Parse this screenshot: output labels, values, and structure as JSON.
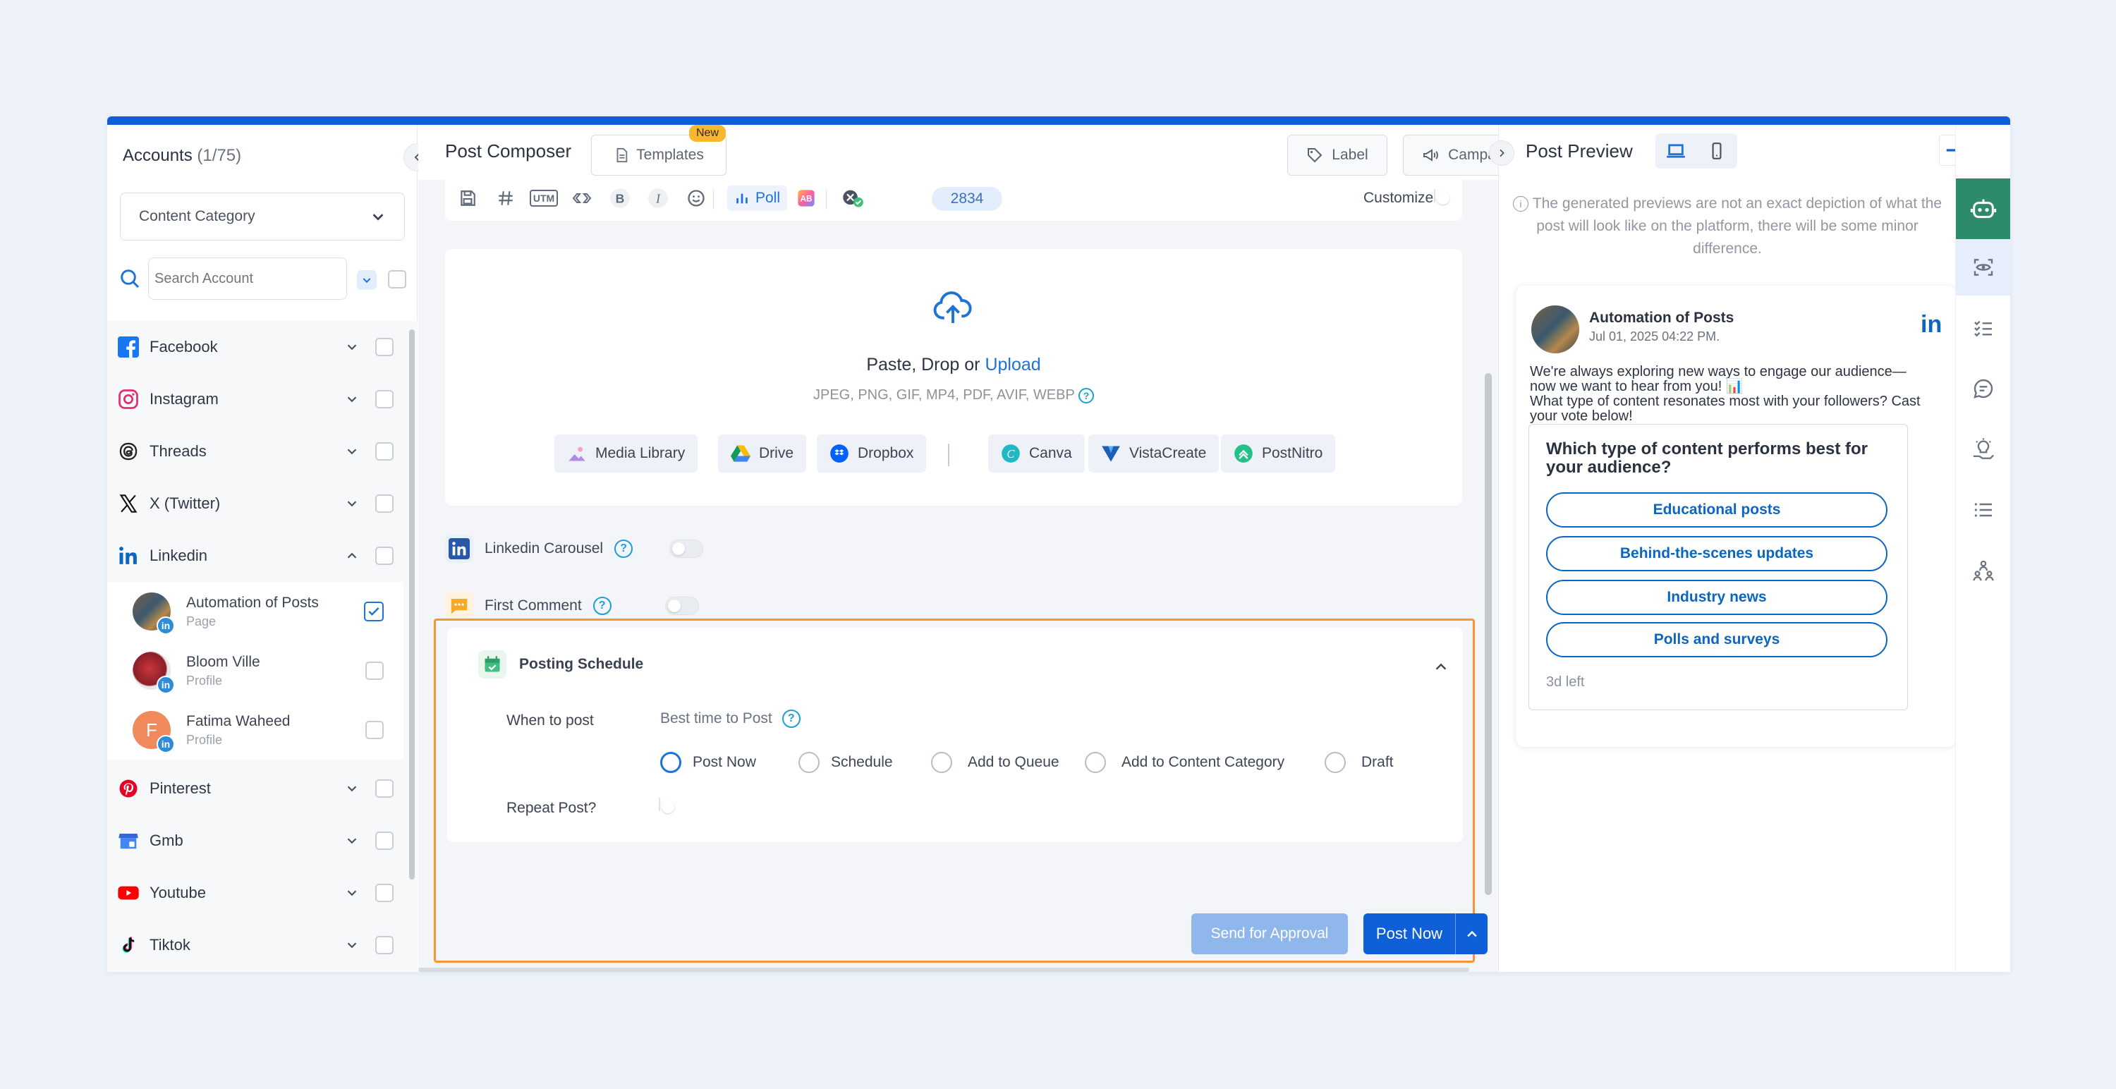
{
  "accounts": {
    "title": "Accounts",
    "count": "(1/75)",
    "category_select": "Content Category",
    "search_placeholder": "Search Account",
    "platforms": [
      {
        "label": "Facebook"
      },
      {
        "label": "Instagram"
      },
      {
        "label": "Threads"
      },
      {
        "label": "X (Twitter)"
      },
      {
        "label": "Linkedin"
      },
      {
        "label": "Pinterest"
      },
      {
        "label": "Gmb"
      },
      {
        "label": "Youtube"
      },
      {
        "label": "Tiktok"
      }
    ],
    "linkedin_accounts": [
      {
        "name": "Automation of Posts",
        "type": "Page"
      },
      {
        "name": "Bloom Ville",
        "type": "Profile"
      },
      {
        "name": "Fatima Waheed",
        "type": "Profile",
        "initial": "F"
      }
    ]
  },
  "composer": {
    "title": "Post Composer",
    "templates_label": "Templates",
    "new_badge": "New",
    "label_btn": "Label",
    "campaign_btn": "Campaign",
    "toolbar": {
      "utm": "UTM",
      "poll": "Poll",
      "char_count": "2834",
      "customize": "Customize"
    },
    "upload": {
      "prompt": "Paste, Drop or ",
      "link": "Upload",
      "formats": "JPEG, PNG, GIF, MP4, PDF, AVIF, WEBP",
      "sources": [
        "Media Library",
        "Drive",
        "Dropbox",
        "Canva",
        "VistaCreate",
        "PostNitro"
      ]
    },
    "linkedin_carousel": "Linkedin Carousel",
    "first_comment": "First Comment",
    "schedule": {
      "title": "Posting Schedule",
      "when_label": "When to post",
      "best_time": "Best time to Post",
      "options": [
        "Post Now",
        "Schedule",
        "Add to Queue",
        "Add to Content Category",
        "Draft"
      ],
      "selected": "Post Now",
      "repeat_label": "Repeat Post?"
    },
    "send_approval": "Send for Approval",
    "post_now": "Post Now"
  },
  "preview": {
    "title": "Post Preview",
    "note": "The generated previews are not an exact depiction of what the post will look like on the platform, there will be some minor difference.",
    "account_name": "Automation of Posts",
    "date": "Jul 01, 2025 04:22 PM.",
    "platform_logo": "in",
    "text_line1": "We're always exploring new ways to engage our audience—now we want to hear from you! 📊",
    "text_line2": "What type of content resonates most with your followers? Cast your vote below!",
    "poll_question": "Which type of content performs best for your audience?",
    "poll_options": [
      "Educational posts",
      "Behind-the-scenes updates",
      "Industry news",
      "Polls and surveys"
    ],
    "poll_remaining": "3d left"
  },
  "colors": {
    "brand_blue": "#0f5fd8",
    "highlight_orange": "#f49631",
    "linkedin_blue": "#0a66c2"
  }
}
